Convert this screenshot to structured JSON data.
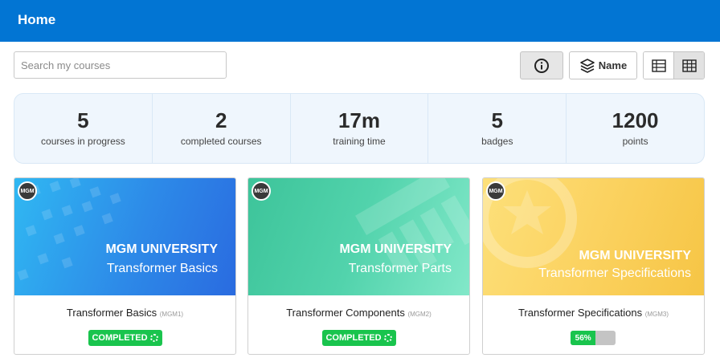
{
  "header": {
    "title": "Home"
  },
  "search": {
    "placeholder": "Search my courses"
  },
  "toolbar": {
    "info_icon": "info-circle-icon",
    "sort_label": "Name",
    "sort_icon": "layers-icon",
    "view_list_icon": "list-view-icon",
    "view_grid_icon": "grid-view-icon",
    "active_view": "grid"
  },
  "stats": [
    {
      "value": "5",
      "label": "courses in progress"
    },
    {
      "value": "2",
      "label": "completed courses"
    },
    {
      "value": "17m",
      "label": "training time"
    },
    {
      "value": "5",
      "label": "badges"
    },
    {
      "value": "1200",
      "label": "points"
    }
  ],
  "courses": [
    {
      "logo": "MGM",
      "banner_line1": "MGM UNIVERSITY",
      "banner_line2": "Transformer Basics",
      "title": "Transformer Basics",
      "code": "(MGM1)",
      "status": "COMPLETED",
      "banner_colors": [
        "#2fb6f0",
        "#2a6fe0"
      ]
    },
    {
      "logo": "MGM",
      "banner_line1": "MGM UNIVERSITY",
      "banner_line2": "Transformer Parts",
      "title": "Transformer Components",
      "code": "(MGM2)",
      "status": "COMPLETED",
      "banner_colors": [
        "#3fc69e",
        "#7ee6c6"
      ]
    },
    {
      "logo": "MGM",
      "banner_line1": "MGM UNIVERSITY",
      "banner_line2": "Transformer Specifications",
      "title": "Transformer Specifications",
      "code": "(MGM3)",
      "progress_label": "56%",
      "progress": 0.56,
      "banner_colors": [
        "#fcd66a",
        "#f7c646"
      ]
    }
  ],
  "colors": {
    "accent": "#0275d3",
    "success": "#19c44d",
    "stats_bg": "#eff6fd"
  }
}
